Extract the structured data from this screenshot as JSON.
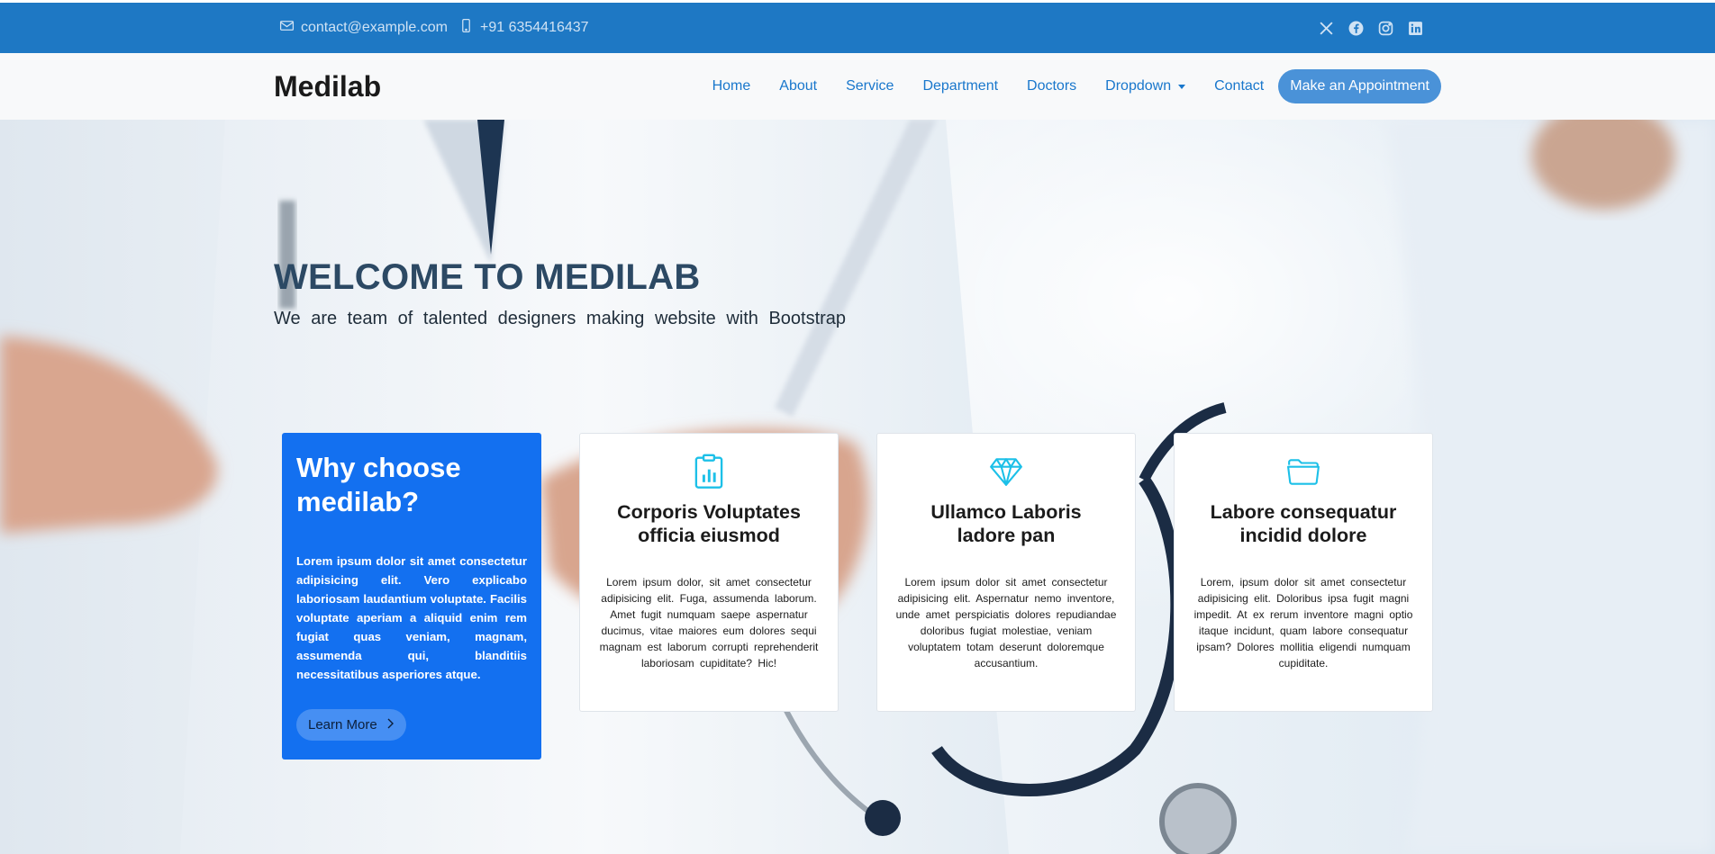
{
  "topbar": {
    "email": "contact@example.com",
    "phone": "+91 6354416437",
    "social_icons": [
      "x-icon",
      "facebook-icon",
      "instagram-icon",
      "linkedin-icon"
    ]
  },
  "header": {
    "logo": "Medilab",
    "nav": [
      "Home",
      "About",
      "Service",
      "Department",
      "Doctors",
      "Dropdown",
      "Contact"
    ],
    "appointment_button": "Make an Appointment"
  },
  "hero": {
    "title": "WELCOME TO MEDILAB",
    "subtitle": "We are team of talented designers making website with Bootstrap"
  },
  "why_box": {
    "title": "Why choose medilab?",
    "text": "Lorem ipsum dolor sit amet consectetur adipisicing elit. Vero explicabo laboriosam laudantium voluptate. Facilis voluptate aperiam a aliquid enim rem fugiat quas veniam, magnam, assumenda qui, blanditiis necessitatibus asperiores atque.",
    "button": "Learn More"
  },
  "cards": [
    {
      "icon": "clipboard-data-icon",
      "title": "Corporis Voluptates officia eiusmod",
      "text": "Lorem ipsum dolor, sit amet consectetur adipisicing elit. Fuga, assumenda laborum. Amet fugit numquam saepe aspernatur ducimus, vitae maiores eum dolores sequi magnam est laborum corrupti reprehenderit laboriosam cupiditate? Hic!"
    },
    {
      "icon": "gem-icon",
      "title": "Ullamco Laboris ladore pan",
      "text": "Lorem ipsum dolor sit amet consectetur adipisicing elit. Aspernatur nemo inventore, unde amet perspiciatis dolores repudiandae doloribus fugiat molestiae, veniam voluptatem totam deserunt doloremque accusantium."
    },
    {
      "icon": "folder-icon",
      "title": "Labore consequatur incidid dolore",
      "text": "Lorem, ipsum dolor sit amet consectetur adipisicing elit. Doloribus ipsa fugit magni impedit. At ex rerum inventore magni optio itaque incidunt, quam labore consequatur ipsam? Dolores mollitia eligendi numquam cupiditate."
    }
  ],
  "colors": {
    "topbar": "#1e78c4",
    "accent": "#1977cc",
    "hero_title": "#2c4964",
    "why_box": "#1370f0",
    "card_icon": "#1cc0e8"
  }
}
